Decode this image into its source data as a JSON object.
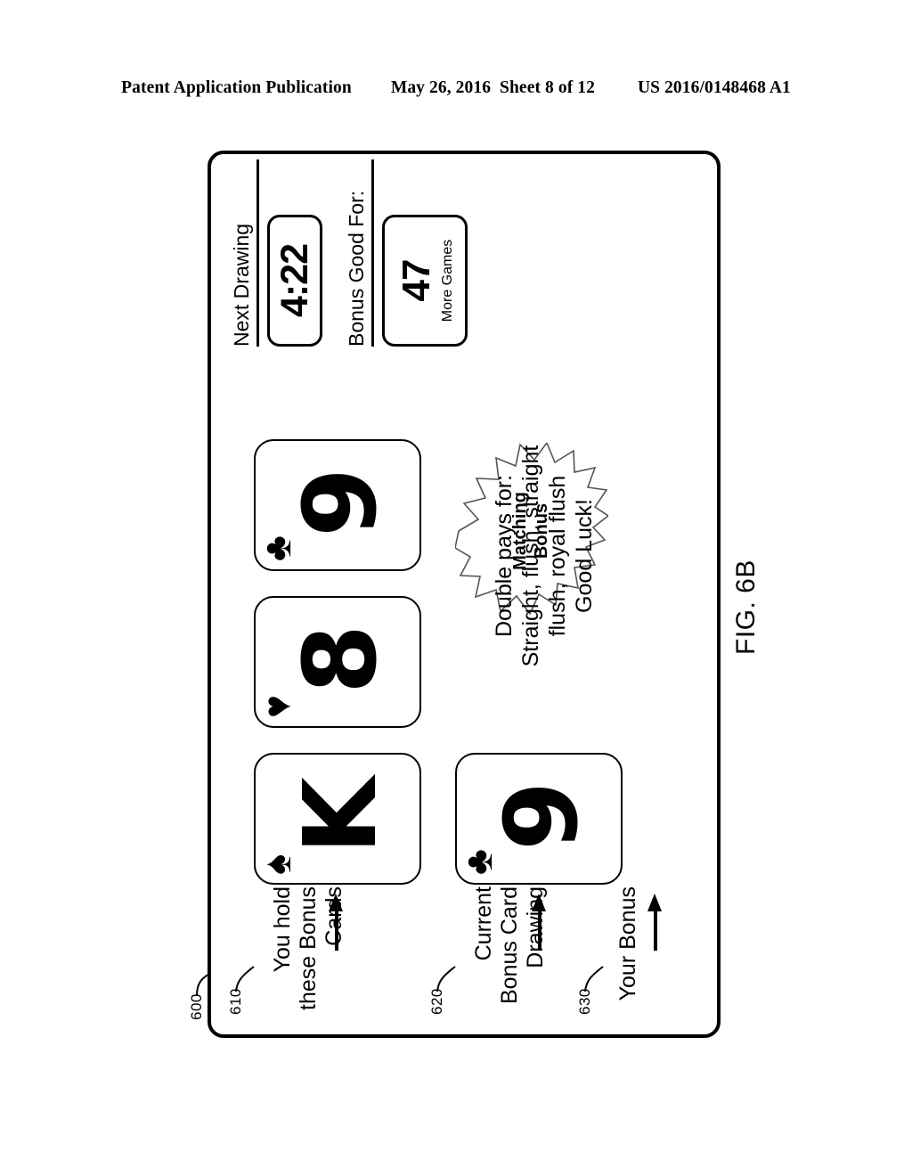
{
  "header": {
    "publication": "Patent Application Publication",
    "date": "May 26, 2016",
    "sheet": "Sheet 8 of 12",
    "patent_number": "US 2016/0148468 A1"
  },
  "figure": {
    "caption": "FIG. 6B",
    "reference_numeral": "600"
  },
  "status": {
    "next_drawing_label": "Next Drawing",
    "next_drawing_value": "4:22",
    "bonus_good_for_label": "Bonus Good For:",
    "bonus_good_for_value": "47",
    "bonus_good_for_caption": "More Games"
  },
  "hold_cards": [
    {
      "rank": "K",
      "suit": "♠",
      "suit_name": "spade"
    },
    {
      "rank": "8",
      "suit": "♥",
      "suit_name": "heart"
    },
    {
      "rank": "9",
      "suit": "♣",
      "suit_name": "club"
    }
  ],
  "drawn_card": {
    "rank": "9",
    "suit": "♣",
    "suit_name": "club"
  },
  "badge": {
    "line1": "Matching",
    "line2": "Bonus"
  },
  "bonus_description": {
    "line1": "Double pays for:",
    "line2": "Straight, flush, straight",
    "line3": "flush, royal flush",
    "line4": "Good Luck!"
  },
  "callouts": [
    {
      "ref": "610",
      "line1": "You hold",
      "line2": "these Bonus",
      "line3": "Cards"
    },
    {
      "ref": "620",
      "line1": "Current",
      "line2": "Bonus Card",
      "line3": "Drawing"
    },
    {
      "ref": "630",
      "line1": "Your Bonus",
      "line2": "",
      "line3": ""
    }
  ],
  "colors": {
    "ink": "#000000",
    "paper": "#ffffff"
  }
}
